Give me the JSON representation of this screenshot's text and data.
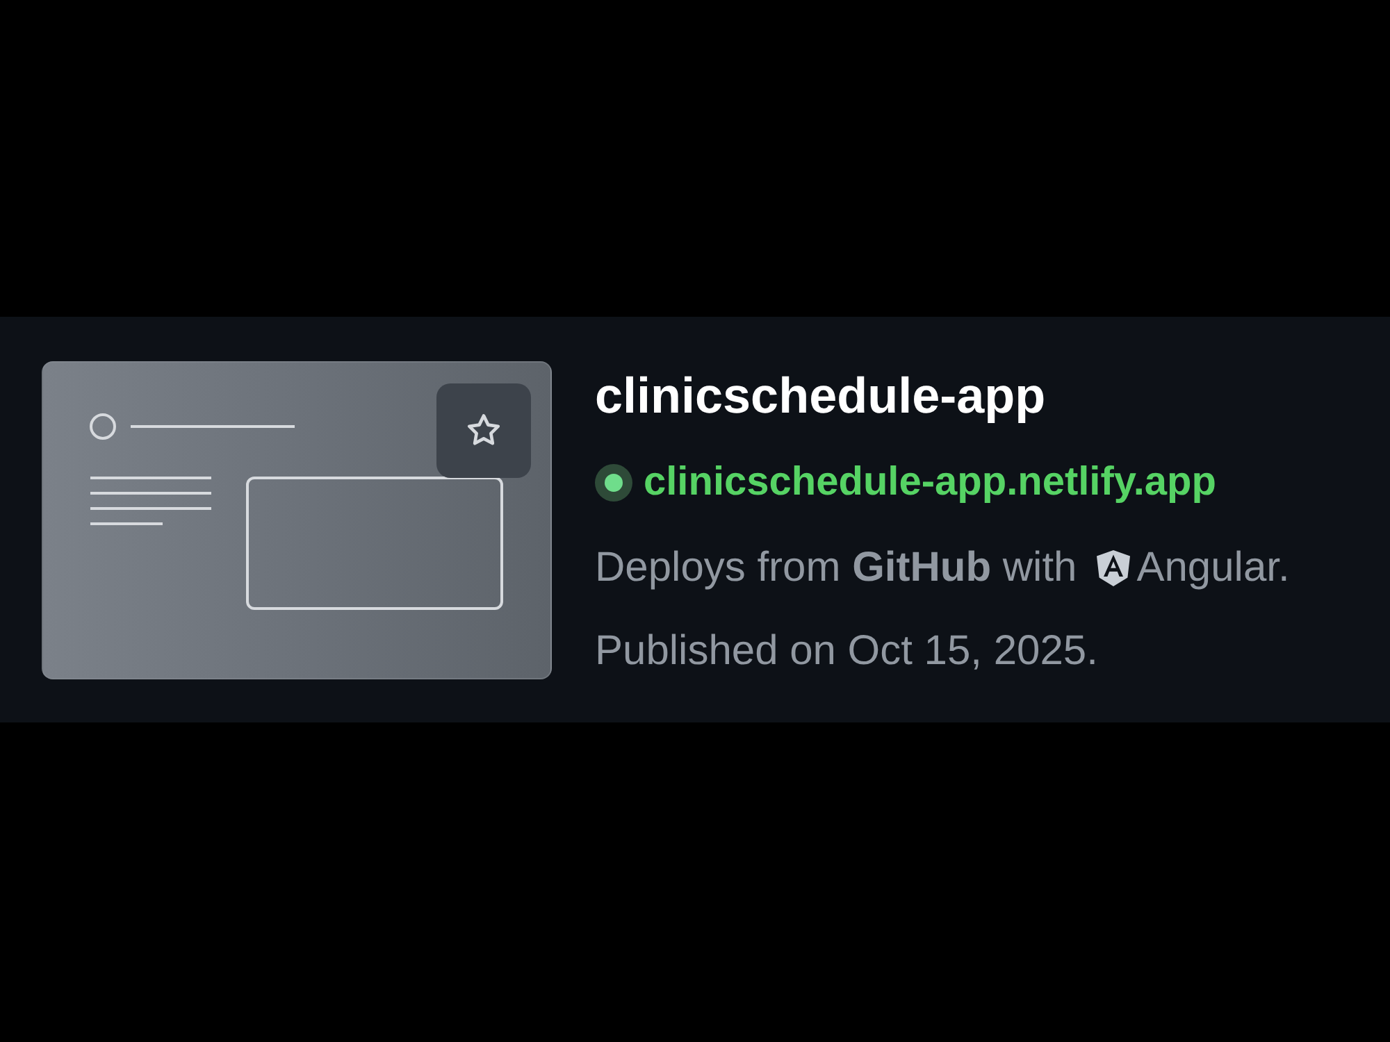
{
  "site": {
    "name": "clinicschedule-app",
    "starred": false,
    "live": true,
    "url": "clinicschedule-app.netlify.app",
    "deploy_text": "Deploys from **GitHub** with",
    "framework": "Angular.",
    "published": "Published on Oct 15, 2025."
  }
}
